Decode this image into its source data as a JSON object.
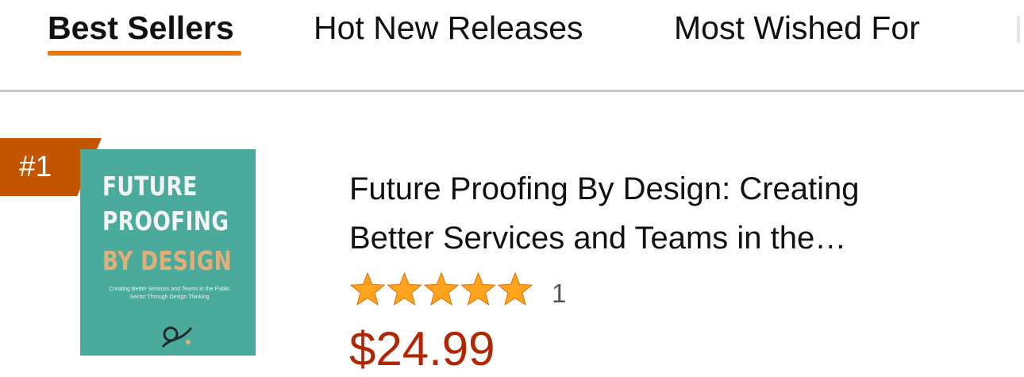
{
  "tabs": [
    {
      "label": "Best Sellers",
      "active": true
    },
    {
      "label": "Hot New Releases",
      "active": false
    },
    {
      "label": "Most Wished For",
      "active": false
    }
  ],
  "colors": {
    "accent": "#e47911",
    "rank_badge": "#c45500",
    "star": "#ffa41c",
    "price": "#b12704",
    "cover_bg": "#4aaa9c"
  },
  "product": {
    "rank": "#1",
    "cover": {
      "line1": "FUTURE",
      "line2": "PROOFING",
      "line3": "BY DESIGN",
      "subtitle": "Creating Better Services and Teams in the Public Sector Through Design Thinking"
    },
    "title_line1": "Future Proofing By Design: Creating",
    "title_line2": "Better Services and Teams in the…",
    "rating": 5,
    "rating_max": 5,
    "review_count": "1",
    "price": "$24.99"
  }
}
